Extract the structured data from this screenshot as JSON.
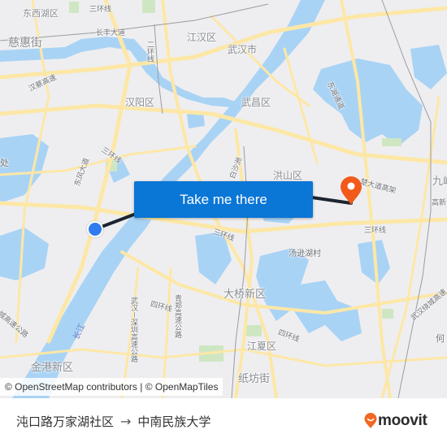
{
  "map": {
    "labels": {
      "dongxihu": "东西湖区",
      "cihui": "慈惠街",
      "jianghan": "江汉区",
      "wuhan_city": "武汉市",
      "hanyang": "汉阳区",
      "wuchang": "武昌区",
      "hongshan": "洪山区",
      "daqiao": "大桥新区",
      "jiangxia": "江夏区",
      "zhifang": "纸坊街",
      "jingang": "金港新区",
      "tangxunhu": "汤逊湖村",
      "jiufeng": "九峰",
      "he": "何",
      "chu_left": "处"
    },
    "roads": {
      "sanhuan_top": "三环线",
      "changfeng": "长丰大道",
      "erhuan": "二环线",
      "hancai": "汉蔡高速",
      "donghu_tunnel": "东湖通道",
      "sanhuan_west": "三环线",
      "dongfeng": "东风大道",
      "baishazhou": "白沙洲",
      "sanhuan_south": "三环线",
      "sanhuan_east": "三环线",
      "luoyu_elevated": "楚大道高架",
      "gaoxin": "高新",
      "sihuan_west": "四环线",
      "sihuan_south": "四环线",
      "wushen": "武汉－深圳高速公路",
      "qingzheng": "青郑高速公路",
      "hanyang_ring": "城高速公路",
      "yangtze": "长江",
      "wuhan_ring": "武汉绕城高速"
    },
    "cta_label": "Take me there",
    "attribution": "© OpenStreetMap contributors | © OpenMapTiles"
  },
  "route": {
    "origin": "沌口路万家湖社区",
    "arrow": "→",
    "destination": "中南民族大学"
  },
  "brand": {
    "name": "moovit",
    "color": "#f26722"
  },
  "colors": {
    "cta": "#0a76d6",
    "start": "#2f7bf0",
    "destination_pin": "#f25a1a",
    "route_line": "#1d2430",
    "water": "#a9d3f5",
    "road": "#fde7a6",
    "land": "#eeeef0",
    "park": "#cfe6c3"
  }
}
